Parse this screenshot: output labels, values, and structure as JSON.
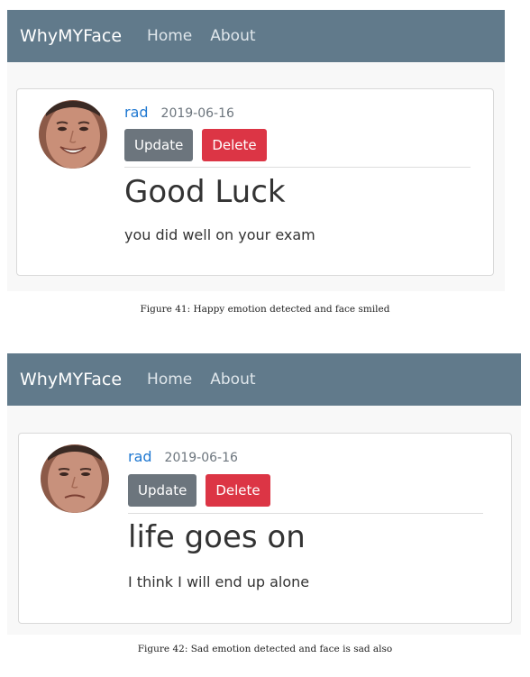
{
  "figures": [
    {
      "navbar": {
        "brand": "WhyMYFace",
        "links": [
          "Home",
          "About"
        ]
      },
      "post": {
        "username": "rad",
        "date": "2019-06-16",
        "update_label": "Update",
        "delete_label": "Delete",
        "title": "Good Luck",
        "body": "you did well on your exam"
      },
      "caption": "Figure 41: Happy emotion detected and face smiled",
      "avatar_expression": "smiling"
    },
    {
      "navbar": {
        "brand": "WhyMYFace",
        "links": [
          "Home",
          "About"
        ]
      },
      "post": {
        "username": "rad",
        "date": "2019-06-16",
        "update_label": "Update",
        "delete_label": "Delete",
        "title": "life goes on",
        "body": "I think I will end up alone"
      },
      "caption": "Figure 42: Sad emotion detected and face is sad also",
      "avatar_expression": "sad"
    }
  ],
  "colors": {
    "navbar_bg": "#617a8b",
    "username": "#1f78d1",
    "update_button": "#6c757d",
    "delete_button": "#dc3545"
  }
}
